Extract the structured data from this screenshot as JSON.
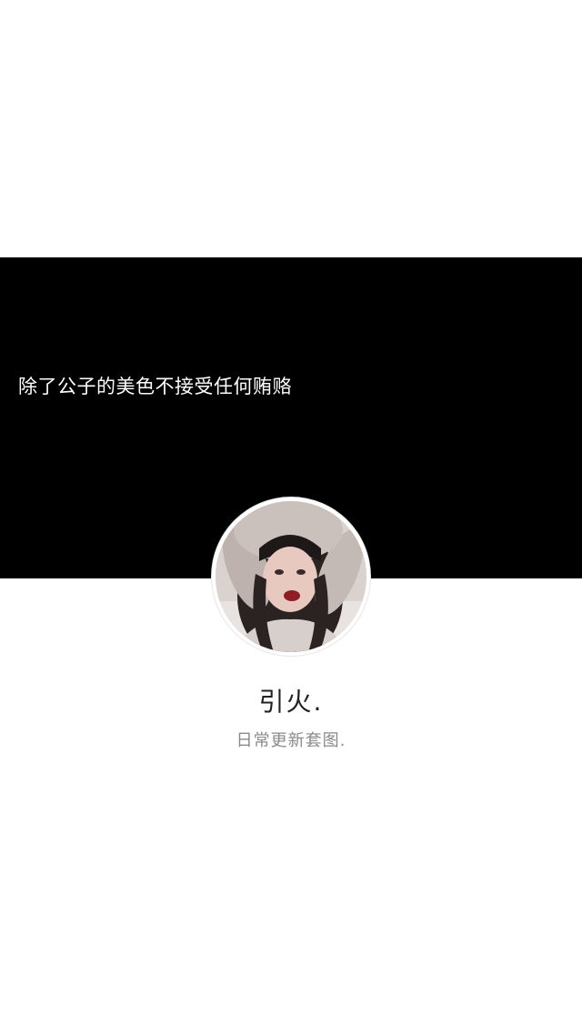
{
  "cover": {
    "text": "除了公子的美色不接受任何贿赂",
    "background_color": "#000000"
  },
  "profile": {
    "avatar_icon": "avatar-photo",
    "nickname": "引火.",
    "bio": "日常更新套图."
  }
}
